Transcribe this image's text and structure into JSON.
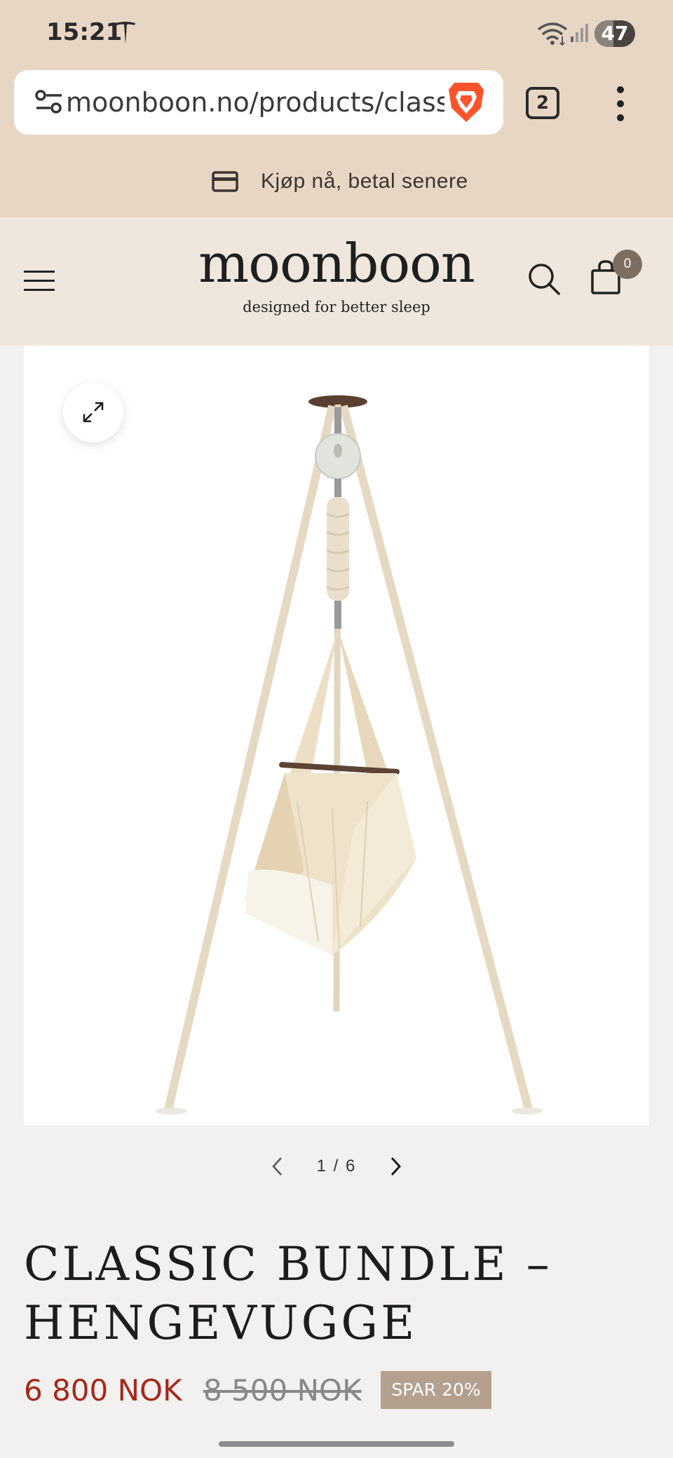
{
  "status_bar": {
    "time": "15:21",
    "battery_level": "47",
    "battery_fraction": 0.47
  },
  "browser": {
    "url": "moonboon.no/products/classic",
    "tab_count": "2",
    "icons": [
      "tune-icon",
      "brave-lion-icon",
      "more-vert-icon"
    ]
  },
  "promo": {
    "text": "Kjøp nå, betal senere",
    "icon": "credit-card-icon"
  },
  "header": {
    "logo": "moonboon",
    "tagline": "designed for better sleep",
    "cart_count": "0",
    "icons": [
      "menu-icon",
      "search-icon",
      "shopping-bag-icon"
    ]
  },
  "gallery": {
    "current": "1",
    "separator": "/",
    "total": "6",
    "pager_text": "1 / 6",
    "icons": [
      "expand-icon",
      "chevron-left-icon",
      "chevron-right-icon"
    ]
  },
  "product": {
    "title": "CLASSIC BUNDLE – HENGEVUGGE",
    "price": "6 800 NOK",
    "old_price": "8 500 NOK",
    "discount_badge": "SPAR 20%"
  },
  "colors": {
    "header_bg": "#e8d6c5",
    "site_header_bg": "#efe7de",
    "price_red": "#a4281b",
    "badge_bg": "#b4a08e"
  }
}
